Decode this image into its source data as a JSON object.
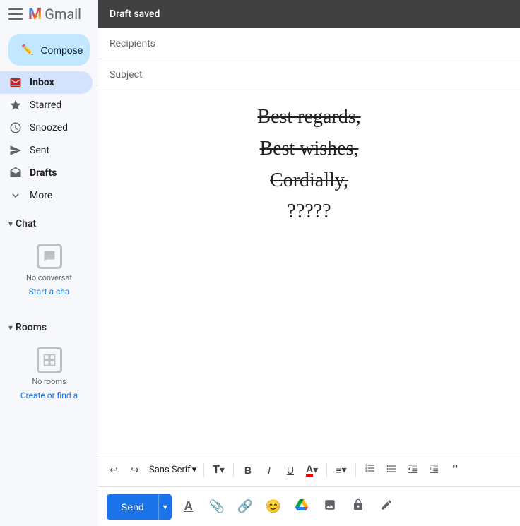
{
  "app": {
    "title": "Gmail",
    "logo_m": "M",
    "logo_text": "Gmail"
  },
  "sidebar": {
    "compose_label": "Compose",
    "nav_items": [
      {
        "id": "inbox",
        "label": "Inbox",
        "active": true,
        "icon": "inbox-icon"
      },
      {
        "id": "starred",
        "label": "Starred",
        "active": false,
        "icon": "star-icon"
      },
      {
        "id": "snoozed",
        "label": "Snoozed",
        "active": false,
        "icon": "clock-icon"
      },
      {
        "id": "sent",
        "label": "Sent",
        "active": false,
        "icon": "send-icon"
      },
      {
        "id": "drafts",
        "label": "Drafts",
        "active": false,
        "icon": "drafts-icon",
        "bold": true
      },
      {
        "id": "more",
        "label": "More",
        "active": false,
        "icon": "chevron-down-icon"
      }
    ],
    "chat_section": {
      "label": "Chat",
      "no_convo_text": "No conversat",
      "start_chat_link": "Start a cha"
    },
    "rooms_section": {
      "label": "Rooms",
      "no_rooms_text": "No rooms",
      "create_link": "Create or find a"
    }
  },
  "compose": {
    "draft_saved_label": "Draft saved",
    "recipients_placeholder": "Recipients",
    "subject_placeholder": "Subject",
    "body_lines": [
      {
        "text": "Best regards,",
        "strikethrough": true
      },
      {
        "text": "Best wishes,",
        "strikethrough": true
      },
      {
        "text": "Cordially,",
        "strikethrough": true
      },
      {
        "text": "?????",
        "strikethrough": false
      }
    ]
  },
  "toolbar": {
    "undo_label": "↩",
    "redo_label": "↪",
    "font_name": "Sans Serif",
    "font_size_label": "T",
    "bold_label": "B",
    "italic_label": "I",
    "underline_label": "U",
    "text_color_label": "A",
    "align_label": "≡",
    "numbered_list_label": "ol",
    "bullet_list_label": "ul",
    "indent_less_label": "←",
    "indent_more_label": "→",
    "quote_label": "\""
  },
  "bottom_bar": {
    "send_label": "Send",
    "font_icon": "A",
    "attach_icon": "📎",
    "link_icon": "🔗",
    "emoji_icon": "😊",
    "drive_icon": "△",
    "photo_icon": "🖼",
    "lock_icon": "🔒",
    "pen_icon": "✎"
  }
}
